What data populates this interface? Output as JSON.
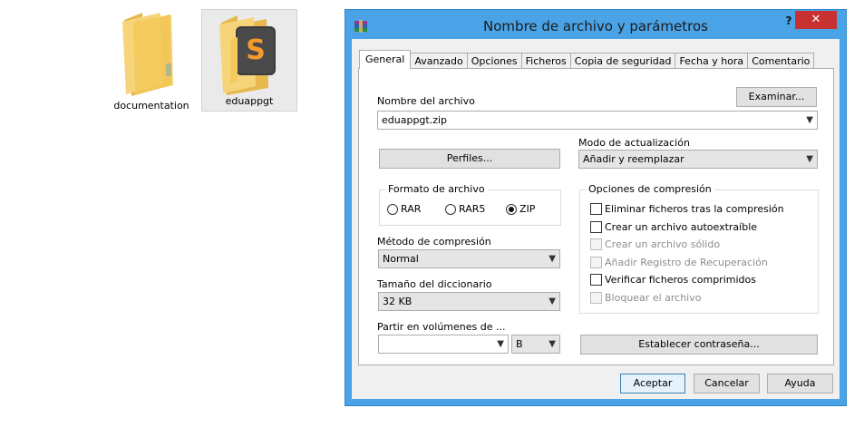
{
  "desktop": {
    "icons": [
      {
        "label": "documentation"
      },
      {
        "label": "eduappgt"
      }
    ]
  },
  "window": {
    "title": "Nombre de archivo y parámetros",
    "help": "?",
    "close": "✕",
    "tabs": [
      {
        "label": "General",
        "active": true
      },
      {
        "label": "Avanzado"
      },
      {
        "label": "Opciones"
      },
      {
        "label": "Ficheros"
      },
      {
        "label": "Copia de seguridad"
      },
      {
        "label": "Fecha y hora"
      },
      {
        "label": "Comentario"
      }
    ],
    "general": {
      "filename_label": "Nombre del archivo",
      "browse_button": "Examinar...",
      "filename_value": "eduappgt.zip",
      "profiles_button": "Perfiles...",
      "update_mode_label": "Modo de actualización",
      "update_mode_value": "Añadir y reemplazar",
      "format_group": "Formato de archivo",
      "formats": [
        {
          "label": "RAR",
          "selected": false
        },
        {
          "label": "RAR5",
          "selected": false
        },
        {
          "label": "ZIP",
          "selected": true
        }
      ],
      "method_label": "Método de compresión",
      "method_value": "Normal",
      "dict_label": "Tamaño del diccionario",
      "dict_value": "32 KB",
      "split_label": "Partir en volúmenes de ...",
      "split_value": "",
      "split_unit": "B",
      "options_group": "Opciones de compresión",
      "options": [
        {
          "label": "Eliminar ficheros tras la compresión",
          "checked": false,
          "enabled": true
        },
        {
          "label": "Crear un archivo autoextraíble",
          "checked": false,
          "enabled": true
        },
        {
          "label": "Crear un archivo sólido",
          "checked": false,
          "enabled": false
        },
        {
          "label": "Añadir Registro de Recuperación",
          "checked": false,
          "enabled": false
        },
        {
          "label": "Verificar ficheros comprimidos",
          "checked": false,
          "enabled": true
        },
        {
          "label": "Bloquear el archivo",
          "checked": false,
          "enabled": false
        }
      ],
      "password_button": "Establecer contraseña..."
    },
    "buttons": {
      "ok": "Aceptar",
      "cancel": "Cancelar",
      "help": "Ayuda"
    }
  },
  "colors": {
    "window_frame": "#4aa3e6",
    "close_button": "#c7312f",
    "folder": "#f3c95b"
  },
  "icons": [
    "folder-icon",
    "sublime-folder-icon",
    "winrar-icon",
    "chevron-down-icon"
  ]
}
